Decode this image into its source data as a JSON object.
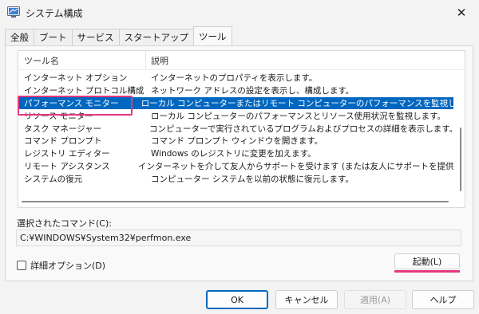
{
  "window": {
    "title": "システム構成",
    "close_glyph": "✕"
  },
  "tabs": [
    {
      "label": "全般"
    },
    {
      "label": "ブート"
    },
    {
      "label": "サービス"
    },
    {
      "label": "スタートアップ"
    },
    {
      "label": "ツール",
      "active": true
    }
  ],
  "tools": {
    "columns": [
      "ツール名",
      "説明"
    ],
    "rows": [
      {
        "name": "インターネット オプション",
        "desc": "インターネットのプロパティを表示します。"
      },
      {
        "name": "インターネット プロトコル構成",
        "desc": "ネットワーク アドレスの設定を表示し、構成します。"
      },
      {
        "name": "パフォーマンス モニター",
        "desc": "ローカル コンピューターまたはリモート コンピューターのパフォーマンスを監視します。",
        "selected": true
      },
      {
        "name": "リソース モニター",
        "desc": "ローカル コンピューターのパフォーマンスとリソース使用状況を監視します。"
      },
      {
        "name": "タスク マネージャー",
        "desc": "コンピューターで実行されているプログラムおよびプロセスの詳細を表示します。"
      },
      {
        "name": "コマンド プロンプト",
        "desc": "コマンド プロンプト ウィンドウを開きます。"
      },
      {
        "name": "レジストリ エディター",
        "desc": "Windows のレジストリに変更を加えます。"
      },
      {
        "name": "リモート アシスタンス",
        "desc": "インターネットを介して友人からサポートを受けます (または友人にサポートを提供します)。"
      },
      {
        "name": "システムの復元",
        "desc": "コンピューター システムを以前の状態に復元します。"
      }
    ]
  },
  "selected_command": {
    "label": "選択されたコマンド(C):",
    "value": "C:¥WINDOWS¥System32¥perfmon.exe"
  },
  "advanced_option": {
    "label": "詳細オプション(D)",
    "checked": false
  },
  "launch_button": "起動(L)",
  "footer": {
    "ok": "OK",
    "cancel": "キャンセル",
    "apply": "適用(A)",
    "help": "ヘルプ"
  },
  "colors": {
    "selection": "#0067c0",
    "highlight_annotation": "#e53780"
  }
}
